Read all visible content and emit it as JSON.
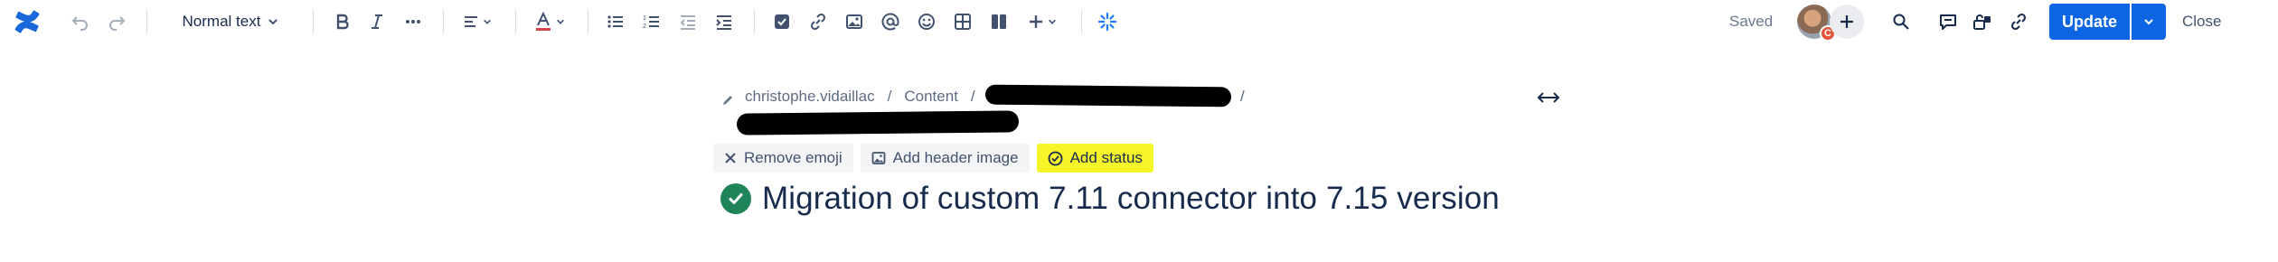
{
  "toolbar": {
    "text_style": "Normal text",
    "saved_label": "Saved",
    "avatar_badge": "C",
    "update_label": "Update",
    "close_label": "Close"
  },
  "breadcrumb": {
    "items": [
      "christophe.vidaillac",
      "Content"
    ]
  },
  "title_actions": {
    "remove_emoji": "Remove emoji",
    "add_header_image": "Add header image",
    "add_status": "Add status"
  },
  "page": {
    "title": "Migration of custom 7.11 connector into 7.15 version"
  },
  "colors": {
    "brand": "#0c66e4",
    "status_highlight": "#f5f52a",
    "emoji_check": "#1f845a",
    "ai_icon": "#1d7afc"
  }
}
